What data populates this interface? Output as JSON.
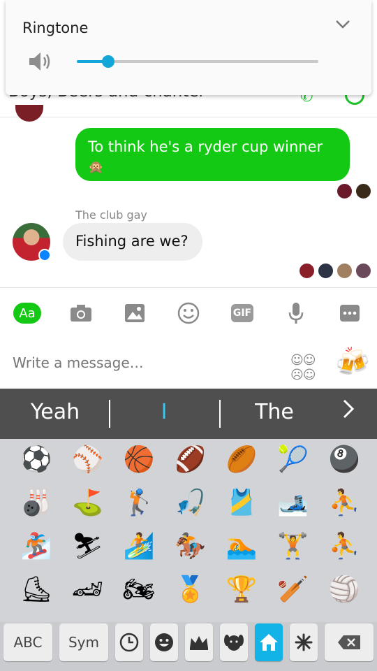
{
  "volume_panel": {
    "title": "Ringtone",
    "level_fraction": 0.13,
    "accent": "#12a7d6"
  },
  "conversation": {
    "title_partial": "Boys, Beers and chanter",
    "messages": [
      {
        "direction": "out",
        "text": "To think he's a ryder cup winner",
        "emoji": "🙊"
      },
      {
        "direction": "in",
        "sender": "The club gay",
        "text": "Fishing are we?"
      }
    ],
    "accent": "#13c913"
  },
  "composer": {
    "aa_label": "Aa",
    "gif_label": "GIF",
    "placeholder": "Write a message…"
  },
  "suggestions": [
    "Yeah",
    "I",
    "The"
  ],
  "emoji_grid": [
    [
      "⚽",
      "⚾",
      "🏀",
      "🏈",
      "🏉",
      "🎾",
      "🎱"
    ],
    [
      "🎳",
      "⛳",
      "🏌",
      "🎣",
      "🎽",
      "🎿",
      "⛹"
    ],
    [
      "🏂",
      "⛷",
      "🏄",
      "🏇",
      "🏊",
      "🏋",
      "⛹"
    ],
    [
      "⛸",
      "🏎",
      "🏍",
      "🏅",
      "🏆",
      "🏏",
      "🏐"
    ]
  ],
  "keyboard": {
    "abc_label": "ABC",
    "sym_label": "Sym",
    "active_accent": "#12b3e6"
  }
}
